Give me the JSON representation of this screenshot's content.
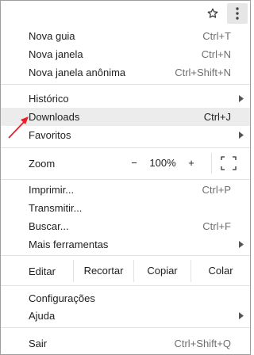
{
  "toolbar": {
    "star_icon": "star-outline-icon",
    "menu_icon": "three-dots-vertical-icon"
  },
  "menu": {
    "new_tab": {
      "label": "Nova guia",
      "shortcut": "Ctrl+T"
    },
    "new_window": {
      "label": "Nova janela",
      "shortcut": "Ctrl+N"
    },
    "new_incognito": {
      "label": "Nova janela anônima",
      "shortcut": "Ctrl+Shift+N"
    },
    "history": {
      "label": "Histórico"
    },
    "downloads": {
      "label": "Downloads",
      "shortcut": "Ctrl+J"
    },
    "bookmarks": {
      "label": "Favoritos"
    },
    "zoom": {
      "label": "Zoom",
      "minus": "−",
      "value": "100%",
      "plus": "+"
    },
    "print": {
      "label": "Imprimir...",
      "shortcut": "Ctrl+P"
    },
    "cast": {
      "label": "Transmitir..."
    },
    "find": {
      "label": "Buscar...",
      "shortcut": "Ctrl+F"
    },
    "more_tools": {
      "label": "Mais ferramentas"
    },
    "edit": {
      "label": "Editar",
      "cut": "Recortar",
      "copy": "Copiar",
      "paste": "Colar"
    },
    "settings": {
      "label": "Configurações"
    },
    "help": {
      "label": "Ajuda"
    },
    "exit": {
      "label": "Sair",
      "shortcut": "Ctrl+Shift+Q"
    }
  },
  "colors": {
    "highlight": "#ececec",
    "annotation_arrow": "#e8202a",
    "shortcut_text": "#6f6f6f"
  }
}
